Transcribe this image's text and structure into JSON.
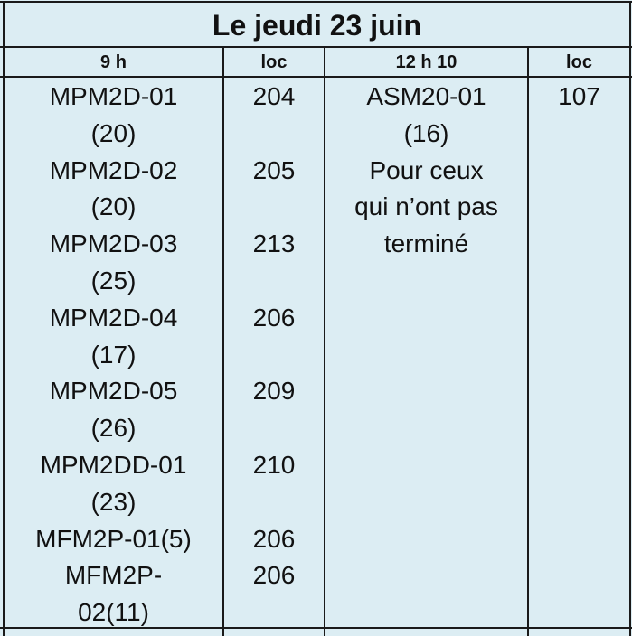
{
  "title": "Le jeudi 23 juin",
  "headers": {
    "col1": "9 h",
    "col2": "loc",
    "col3": "12 h 10",
    "col4": "loc"
  },
  "col1_lines": [
    "MPM2D-01",
    "(20)",
    "MPM2D-02",
    "(20)",
    "MPM2D-03",
    "(25)",
    "MPM2D-04",
    "(17)",
    "MPM2D-05",
    "(26)",
    "MPM2DD-01",
    "(23)",
    "MFM2P-01(5)",
    "MFM2P-",
    "02(11)"
  ],
  "col2_lines": [
    "204",
    "",
    "205",
    "",
    "213",
    "",
    "206",
    "",
    "209",
    "",
    "210",
    "",
    "206",
    "206",
    ""
  ],
  "col3_lines": [
    "ASM20-01",
    "(16)",
    "Pour ceux",
    "qui n’ont pas",
    "terminé"
  ],
  "col4_lines": [
    "107"
  ]
}
